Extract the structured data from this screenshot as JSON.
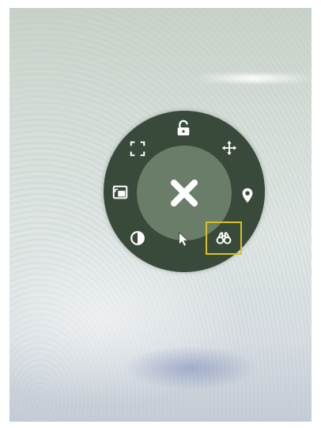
{
  "menu": {
    "close": "close-icon",
    "items": [
      {
        "icon": "unlock-icon"
      },
      {
        "icon": "move-arrows-icon"
      },
      {
        "icon": "location-pin-icon"
      },
      {
        "icon": "binoculars-icon",
        "selected": true
      },
      {
        "icon": "pointer-cursor-icon"
      },
      {
        "icon": "contrast-icon"
      },
      {
        "icon": "picture-in-picture-icon"
      },
      {
        "icon": "fullscreen-corners-icon"
      }
    ]
  },
  "colors": {
    "ring": "#3a4a3a",
    "inner": "#6a7d69",
    "icon": "#ffffff",
    "highlight": "#d9c21f"
  }
}
